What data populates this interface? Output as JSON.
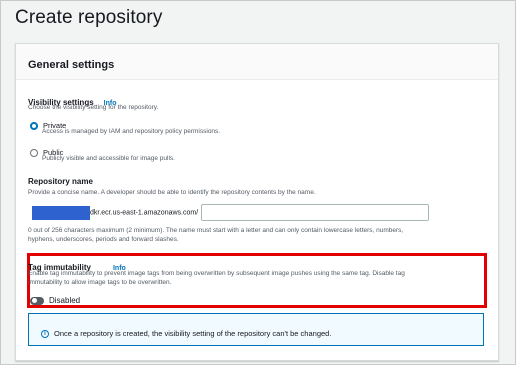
{
  "page": {
    "title": "Create repository"
  },
  "general_settings": {
    "title": "General settings"
  },
  "visibility": {
    "label": "Visibility settings",
    "info": "Info",
    "description": "Choose the visibility setting for the repository.",
    "selected": "Private",
    "options": [
      {
        "label": "Private",
        "description": "Access is managed by IAM and repository policy permissions."
      },
      {
        "label": "Public",
        "description": "Publicly visible and accessible for image pulls."
      }
    ]
  },
  "repository_name": {
    "label": "Repository name",
    "description": "Provide a concise name. A developer should be able to identify the repository contents by the name.",
    "prefix": "dkr.ecr.us-east-1.amazonaws.com/",
    "value": "",
    "hint_line1": "0 out of 256 characters maximum (2 minimum). The name must start with a letter and can only contain lowercase letters, numbers,",
    "hint_line2": "hyphens, underscores, periods and forward slashes."
  },
  "tag_immutability": {
    "label": "Tag immutability",
    "info": "Info",
    "description_line1": "Enable tag immutability to prevent image tags from being overwritten by subsequent image pushes using the same tag. Disable tag",
    "description_line2": "immutability to allow image tags to be overwritten.",
    "toggle_label": "Disabled",
    "enabled": false
  },
  "alert": {
    "icon": "info-circle-icon",
    "text": "Once a repository is created, the visibility setting of the repository can't be changed."
  },
  "colors": {
    "accent": "#0073bb",
    "highlight_border": "#e30000",
    "redaction": "#2e62cf"
  }
}
